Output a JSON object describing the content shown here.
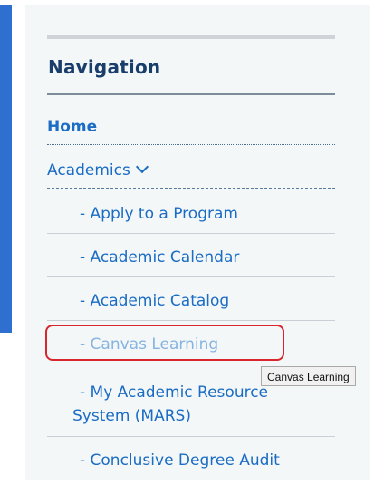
{
  "navigation": {
    "title": "Navigation",
    "home_label": "Home",
    "academics_label": "Academics",
    "sub_items": [
      {
        "label": "- Apply to a Program"
      },
      {
        "label": "- Academic Calendar"
      },
      {
        "label": "- Academic Catalog"
      },
      {
        "label": "- Canvas Learning"
      },
      {
        "label_line1": "- My Academic Resource",
        "label_line2": "System (MARS)"
      },
      {
        "label": "- Conclusive Degree Audit"
      }
    ]
  },
  "tooltip": {
    "text": "Canvas Learning"
  },
  "colors": {
    "accent_bar": "#2f6fcf",
    "link": "#1a6cc4",
    "title": "#1a3e6b",
    "highlight": "#d9262c"
  },
  "icons": {
    "academics_toggle": "chevron-down-icon"
  }
}
